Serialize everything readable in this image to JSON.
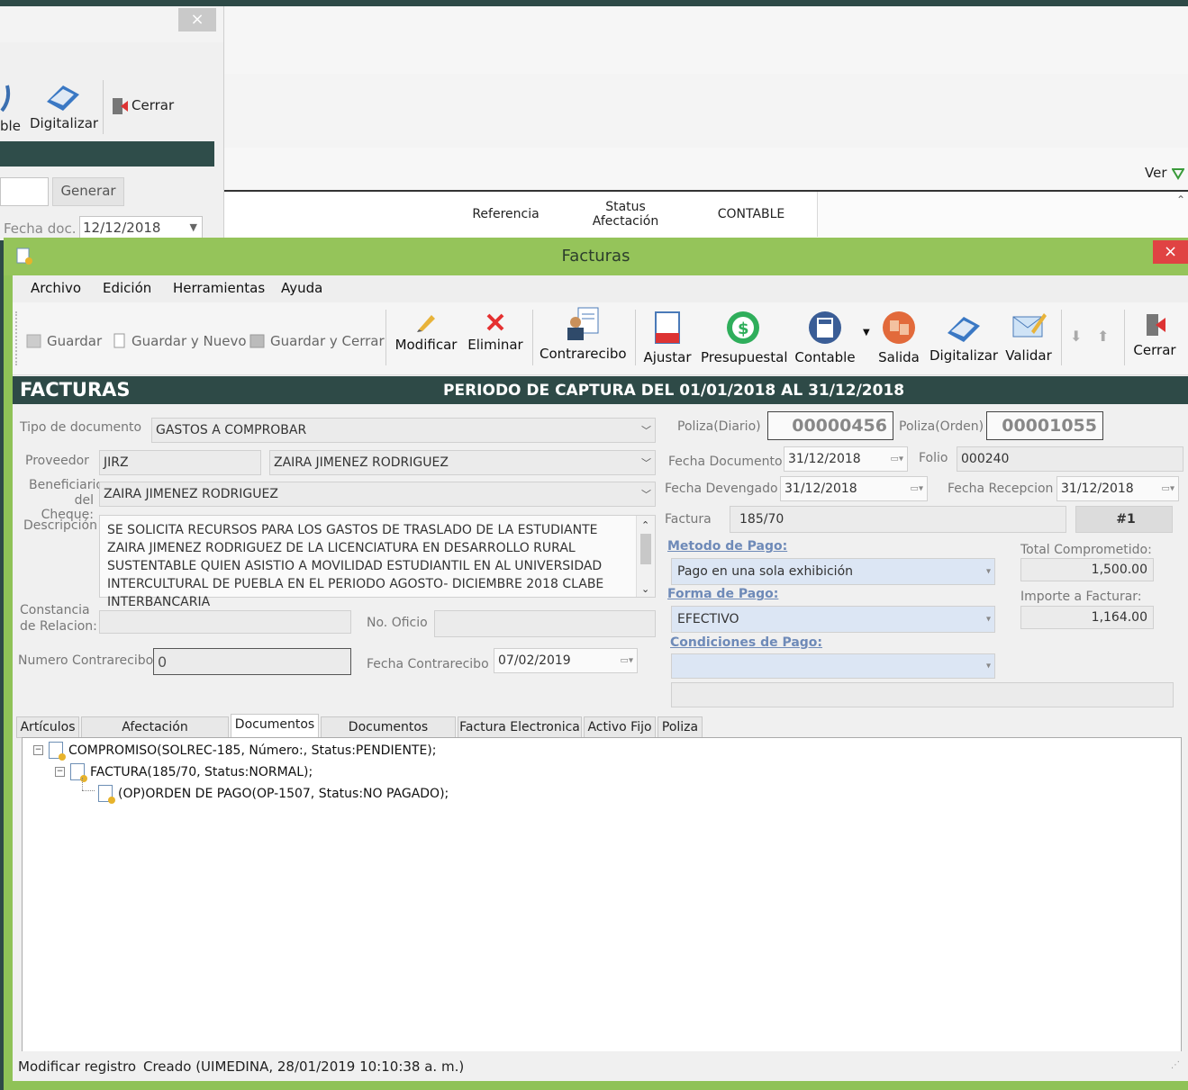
{
  "bg_window": {
    "close": "×",
    "partial_label": "ble",
    "digitalizar": "Digitalizar",
    "cerrar": "Cerrar",
    "generar": "Generar",
    "fecha_doc_label": "Fecha doc.",
    "fecha_doc_value": "12/12/2018"
  },
  "bg_grid": {
    "ver_label": "Ver",
    "col_referencia": "Referencia",
    "col_status_1": "Status",
    "col_status_2": "Afectación",
    "col_contable": "CONTABLE"
  },
  "window": {
    "title": "Facturas",
    "close": "×"
  },
  "menu": [
    "Archivo",
    "Edición",
    "Herramientas",
    "Ayuda"
  ],
  "toolbar": {
    "guardar": "Guardar",
    "guardar_nuevo": "Guardar y Nuevo",
    "guardar_cerrar": "Guardar y Cerrar",
    "modificar": "Modificar",
    "eliminar": "Eliminar",
    "contrarecibo": "Contrarecibo",
    "ajustar": "Ajustar",
    "presupuestal": "Presupuestal",
    "contable": "Contable",
    "salida": "Salida",
    "digitalizar": "Digitalizar",
    "validar": "Validar",
    "cerrar": "Cerrar"
  },
  "header": {
    "title": "FACTURAS",
    "periodo": "PERIODO DE CAPTURA DEL 01/01/2018 AL 31/12/2018"
  },
  "form": {
    "tipo_documento_label": "Tipo de documento",
    "tipo_documento_value": "GASTOS A COMPROBAR",
    "proveedor_label": "Proveedor",
    "proveedor_code": "JIRZ",
    "proveedor_name": "ZAIRA JIMENEZ RODRIGUEZ",
    "beneficiario_label_1": "Beneficiario",
    "beneficiario_label_2": "del Cheque:",
    "beneficiario_value": "ZAIRA JIMENEZ RODRIGUEZ",
    "descripcion_label": "Descripción",
    "descripcion_value": "SE SOLICITA RECURSOS PARA LOS GASTOS DE TRASLADO  DE LA ESTUDIANTE ZAIRA JIMENEZ RODRIGUEZ DE LA LICENCIATURA EN DESARROLLO RURAL SUSTENTABLE QUIEN ASISTIO A MOVILIDAD ESTUDIANTIL EN AL UNIVERSIDAD INTERCULTURAL DE PUEBLA EN EL PERIODO AGOSTO- DICIEMBRE 2018 CLABE INTERBANCARIA",
    "constancia_label_1": "Constancia",
    "constancia_label_2": "de Relacion:",
    "no_oficio_label": "No. Oficio",
    "numero_contrarecibo_label": "Numero Contrarecibo",
    "numero_contrarecibo_value": "0",
    "fecha_contrarecibo_label": "Fecha Contrarecibo",
    "fecha_contrarecibo_value": "07/02/2019",
    "poliza_diario_label": "Poliza(Diario)",
    "poliza_diario_value": "00000456",
    "poliza_orden_label": "Poliza(Orden)",
    "poliza_orden_value": "00001055",
    "fecha_documento_label": "Fecha Documento",
    "fecha_documento_value": "31/12/2018",
    "folio_label": "Folio",
    "folio_value": "000240",
    "fecha_devengado_label": "Fecha Devengado",
    "fecha_devengado_value": "31/12/2018",
    "fecha_recepcion_label": "Fecha Recepcion",
    "fecha_recepcion_value": "31/12/2018",
    "factura_label": "Factura",
    "factura_value": "185/70",
    "factura_num": "#1",
    "metodo_pago_label": "Metodo de Pago:",
    "metodo_pago_value": "Pago en una sola exhibición",
    "forma_pago_label": "Forma de Pago:",
    "forma_pago_value": "EFECTIVO",
    "condiciones_pago_label": "Condiciones de Pago:",
    "total_comprometido_label": "Total Comprometido:",
    "total_comprometido_value": "1,500.00",
    "importe_facturar_label": "Importe a Facturar:",
    "importe_facturar_value": "1,164.00"
  },
  "tabs": [
    "Artículos",
    "Afectación presupuestal",
    "Documentos",
    "Documentos Digitales",
    "Factura Electronica",
    "Activo Fijo",
    "Poliza"
  ],
  "tree": [
    "COMPROMISO(SOLREC-185, Número:, Status:PENDIENTE);",
    "FACTURA(185/70, Status:NORMAL);",
    "(OP)ORDEN DE PAGO(OP-1507, Status:NO PAGADO);"
  ],
  "status": {
    "action": "Modificar registro",
    "created": "Creado (UIMEDINA, 28/01/2019 10:10:38 a. m.)"
  },
  "colors": {
    "accent_green": "#8fc257",
    "dark_teal": "#2e4a47",
    "close_red": "#e04343"
  }
}
